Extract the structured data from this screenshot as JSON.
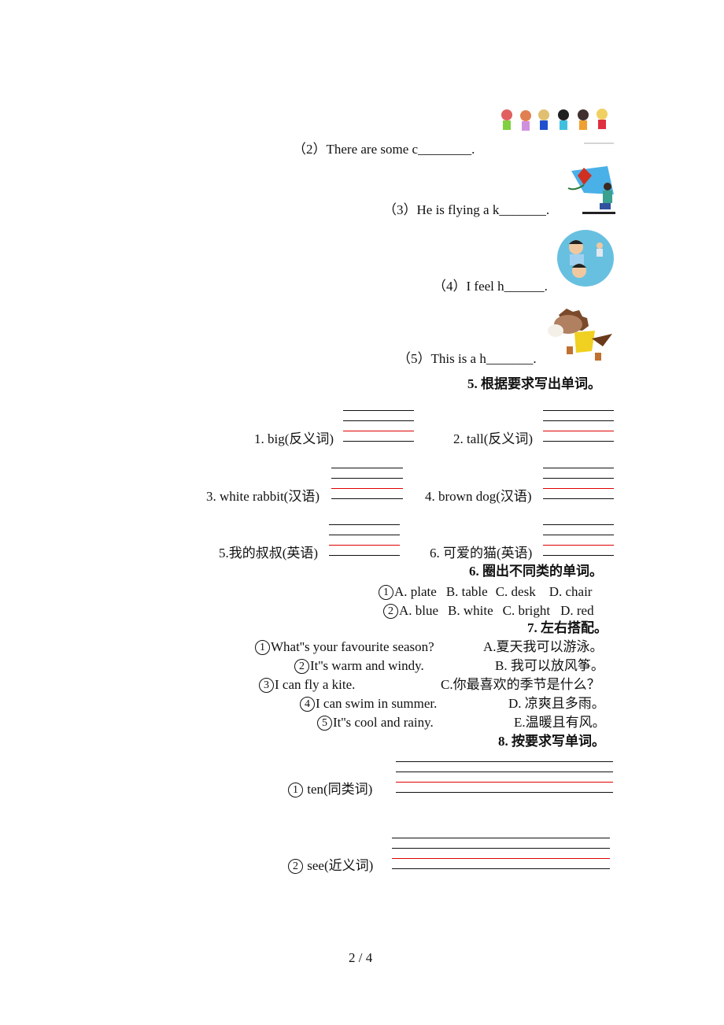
{
  "page": {
    "number": "2 / 4"
  },
  "picture_items": [
    {
      "num": "（2）",
      "text": "There are some c________.",
      "image": "children-holding-hands-picture"
    },
    {
      "num": "（3）",
      "text": "He is flying a k_______.",
      "image": "boy-flying-kite-picture"
    },
    {
      "num": "（4）",
      "text": "I feel h______.",
      "image": "happy-man-picture"
    },
    {
      "num": "（5）",
      "text": "This is a h_______.",
      "image": "horse-cartoon-picture"
    }
  ],
  "section5": {
    "title": "5. 根据要求写出单词。",
    "items": [
      {
        "label": "1. big(反义词)"
      },
      {
        "label": "2. tall(反义词)"
      },
      {
        "label": "3. white rabbit(汉语)"
      },
      {
        "label": "4. brown dog(汉语)"
      },
      {
        "label": "5.我的叔叔(英语)"
      },
      {
        "label": "6. 可爱的猫(英语)"
      }
    ]
  },
  "section6": {
    "title": "6. 圈出不同类的单词。",
    "rows": [
      {
        "num": "1",
        "options": [
          "A. plate",
          "B. table",
          "C. desk",
          "D. chair"
        ]
      },
      {
        "num": "2",
        "options": [
          "A. blue",
          "B. white",
          "C. bright",
          "D. red"
        ]
      }
    ]
  },
  "section7": {
    "title": "7. 左右搭配。",
    "left": [
      {
        "num": "1",
        "text": "What''s your favourite season?"
      },
      {
        "num": "2",
        "text": "It''s warm and windy."
      },
      {
        "num": "3",
        "text": "I can fly a kite."
      },
      {
        "num": "4",
        "text": "I can swim in summer."
      },
      {
        "num": "5",
        "text": "It''s cool and rainy."
      }
    ],
    "right": [
      "A.夏天我可以游泳。",
      "B. 我可以放风筝。",
      "C.你最喜欢的季节是什么？",
      "D. 凉爽且多雨。",
      "E.温暖且有风。"
    ]
  },
  "section8": {
    "title": "8. 按要求写单词。",
    "items": [
      {
        "num": "1",
        "label": "ten(同类词)"
      },
      {
        "num": "2",
        "label": "see(近义词)"
      }
    ]
  },
  "colors": {
    "guide_red": "#e00000",
    "guide_black": "#111111"
  }
}
